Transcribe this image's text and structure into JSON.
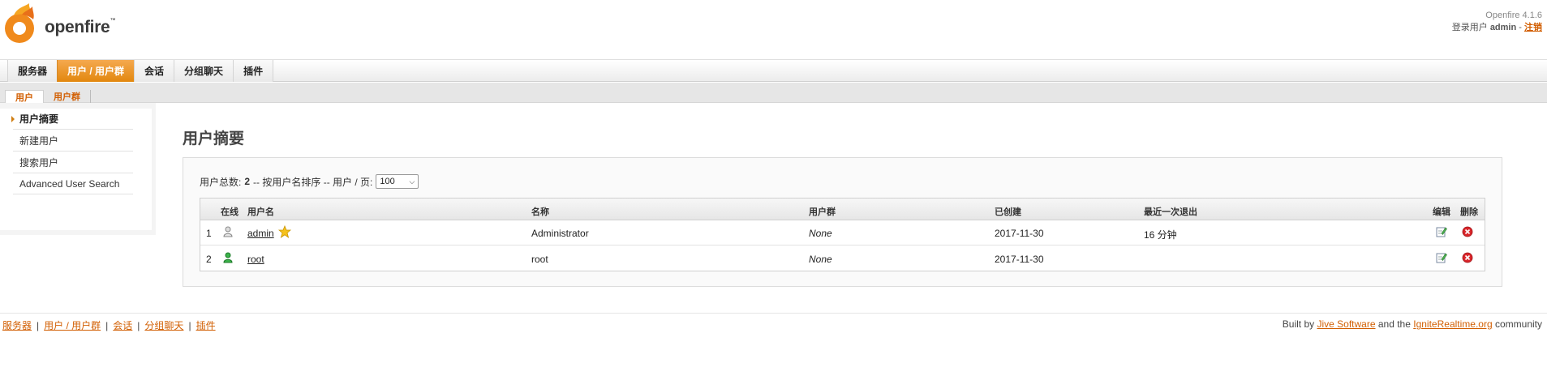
{
  "header": {
    "logo_text": "openfire",
    "version": "Openfire 4.1.6",
    "login_prefix": "登录用户",
    "username": "admin",
    "separator": " - ",
    "logout": "注销"
  },
  "tabs": [
    {
      "label": "服务器"
    },
    {
      "label": "用户 / 用户群"
    },
    {
      "label": "会话"
    },
    {
      "label": "分组聊天"
    },
    {
      "label": "插件"
    }
  ],
  "subtabs": [
    {
      "label": "用户"
    },
    {
      "label": "用户群"
    }
  ],
  "sidebar": {
    "items": [
      {
        "label": "用户摘要"
      },
      {
        "label": "新建用户"
      },
      {
        "label": "搜索用户"
      },
      {
        "label": "Advanced User Search"
      }
    ]
  },
  "main": {
    "title": "用户摘要",
    "summary_prefix": "用户总数:",
    "total": "2",
    "summary_middle": "-- 按用户名排序 -- 用户 / 页:",
    "per_page": "100",
    "columns": {
      "online": "在线",
      "username": "用户名",
      "name": "名称",
      "groups": "用户群",
      "created": "已创建",
      "last_logout": "最近一次退出",
      "edit": "编辑",
      "delete": "删除"
    },
    "rows": [
      {
        "index": "1",
        "username": "admin",
        "name": "Administrator",
        "groups": "None",
        "created": "2017-11-30",
        "last_logout": "16 分钟"
      },
      {
        "index": "2",
        "username": "root",
        "name": "root",
        "groups": "None",
        "created": "2017-11-30",
        "last_logout": ""
      }
    ]
  },
  "footer": {
    "links": [
      {
        "label": "服务器"
      },
      {
        "label": "用户 / 用户群"
      },
      {
        "label": "会话"
      },
      {
        "label": "分组聊天"
      },
      {
        "label": "插件"
      }
    ],
    "sep": "|",
    "built_prefix": "Built by",
    "jive": "Jive Software",
    "and_the": "and the",
    "ignite": "IgniteRealtime.org",
    "community": "community"
  },
  "colors": {
    "accent": "#e2870e",
    "link": "#d25f03"
  },
  "icons": [
    "openfire-logo",
    "user-offline-icon",
    "user-online-icon",
    "admin-star-icon",
    "edit-icon",
    "delete-icon",
    "dropdown-chevron-icon"
  ]
}
